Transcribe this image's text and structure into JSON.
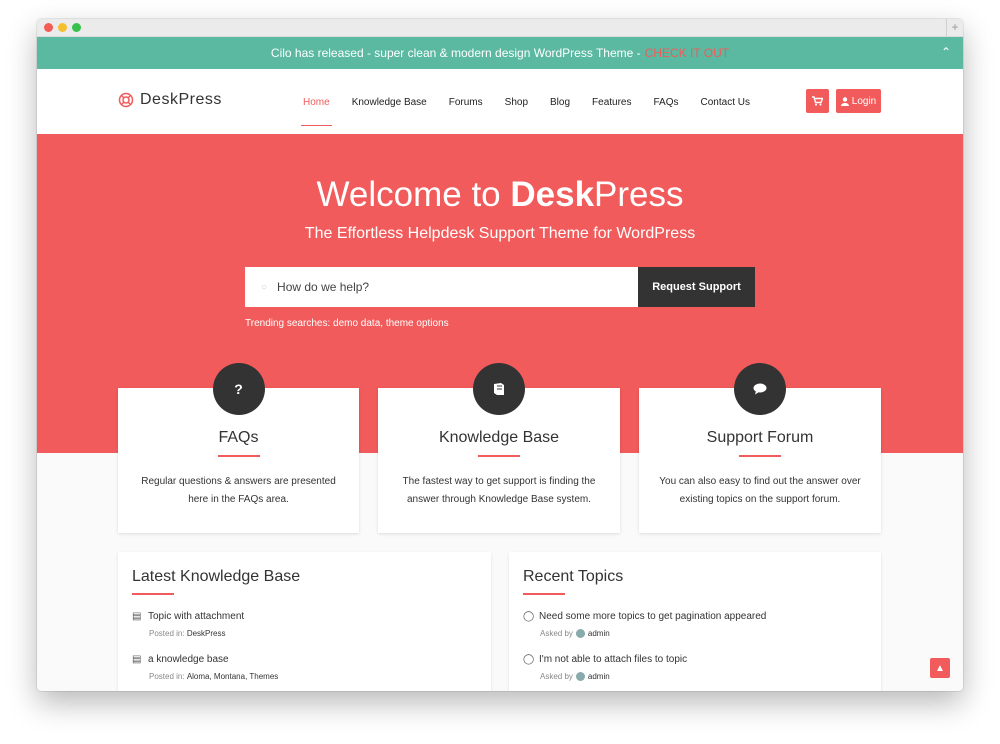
{
  "announcement": {
    "text": "Cilo has released - super clean & modern design WordPress Theme - ",
    "cta": "CHECK IT OUT"
  },
  "header": {
    "logo_text": "DeskPress",
    "nav": [
      {
        "label": "Home",
        "active": true
      },
      {
        "label": "Knowledge Base"
      },
      {
        "label": "Forums"
      },
      {
        "label": "Shop"
      },
      {
        "label": "Blog"
      },
      {
        "label": "Features"
      },
      {
        "label": "FAQs"
      },
      {
        "label": "Contact Us"
      }
    ],
    "login_label": "Login"
  },
  "hero": {
    "title_prefix": "Welcome to ",
    "title_brand_bold": "Desk",
    "title_brand_rest": "Press",
    "subtitle": "The Effortless Helpdesk Support Theme for WordPress",
    "search_placeholder": "How do we help?",
    "request_button": "Request Support",
    "trending": "Trending searches: demo data, theme options"
  },
  "cards": [
    {
      "icon": "?",
      "title": "FAQs",
      "desc": "Regular questions & answers are presented here in the FAQs area."
    },
    {
      "icon": "book",
      "title": "Knowledge Base",
      "desc": "The fastest way to get support is finding the answer through Knowledge Base system."
    },
    {
      "icon": "chat",
      "title": "Support Forum",
      "desc": "You can also easy to find out the answer over existing topics on the support forum."
    }
  ],
  "latest_kb": {
    "title": "Latest Knowledge Base",
    "items": [
      {
        "title": "Topic with attachment",
        "meta_label": "Posted in:",
        "meta_value": "DeskPress"
      },
      {
        "title": "a knowledge base",
        "meta_label": "Posted in:",
        "meta_value": "Aloma, Montana, Themes"
      }
    ]
  },
  "recent_topics": {
    "title": "Recent Topics",
    "items": [
      {
        "title": "Need some more topics to get pagination appeared",
        "meta_label": "Asked by",
        "meta_value": "admin"
      },
      {
        "title": "I'm not able to attach files to topic",
        "meta_label": "Asked by",
        "meta_value": "admin"
      }
    ]
  },
  "colors": {
    "accent": "#f15b5b",
    "teal": "#5ab9a0",
    "dark": "#333333"
  }
}
